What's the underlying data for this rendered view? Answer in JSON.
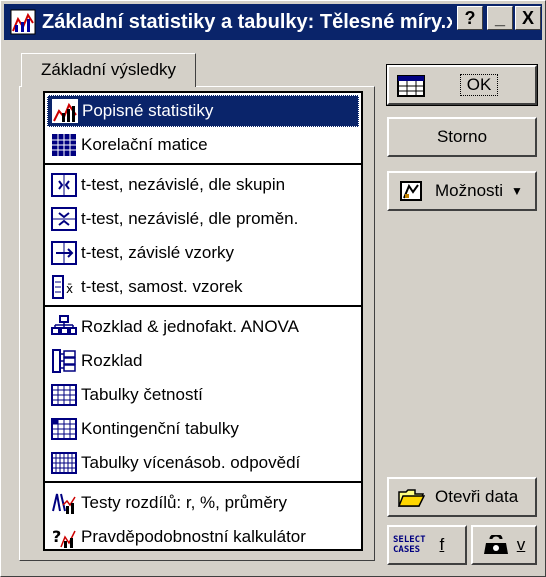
{
  "window": {
    "title": "Základní statistiky a tabulky: Tělesné míry.x",
    "help_label": "?",
    "minimize_label": "_",
    "close_label": "X"
  },
  "tab": {
    "label": "Základní výsledky"
  },
  "list": {
    "items": [
      {
        "label": "Popisné statistiky",
        "icon": "descriptive-stats-icon"
      },
      {
        "label": "Korelační matice",
        "icon": "correlation-matrix-icon"
      },
      {
        "label": "t-test, nezávislé, dle skupin",
        "icon": "ttest-groups-icon"
      },
      {
        "label": "t-test, nezávislé, dle proměn.",
        "icon": "ttest-variables-icon"
      },
      {
        "label": "t-test, závislé vzorky",
        "icon": "ttest-dependent-icon"
      },
      {
        "label": "t-test, samost. vzorek",
        "icon": "ttest-single-icon"
      },
      {
        "label": "Rozklad & jednofakt. ANOVA",
        "icon": "anova-icon"
      },
      {
        "label": "Rozklad",
        "icon": "breakdown-icon"
      },
      {
        "label": "Tabulky četností",
        "icon": "frequency-table-icon"
      },
      {
        "label": "Kontingenční tabulky",
        "icon": "crosstab-icon"
      },
      {
        "label": "Tabulky vícenásob. odpovědí",
        "icon": "multiple-response-icon"
      },
      {
        "label": "Testy rozdílů: r, %, průměry",
        "icon": "difference-tests-icon"
      },
      {
        "label": "Pravděpodobnostní kalkulátor",
        "icon": "probability-calc-icon"
      }
    ],
    "selected_index": 0
  },
  "buttons": {
    "ok": "OK",
    "cancel": "Storno",
    "options": "Možnosti",
    "open_data": "Otevři data",
    "select_cases_line1": "SELECT",
    "select_cases_line2": "CASES",
    "select_cases_label": "f",
    "weight_label": "v"
  },
  "colors": {
    "face": "#d4d0c8",
    "title_bar": "#0a246a",
    "selection": "#0a246a"
  }
}
